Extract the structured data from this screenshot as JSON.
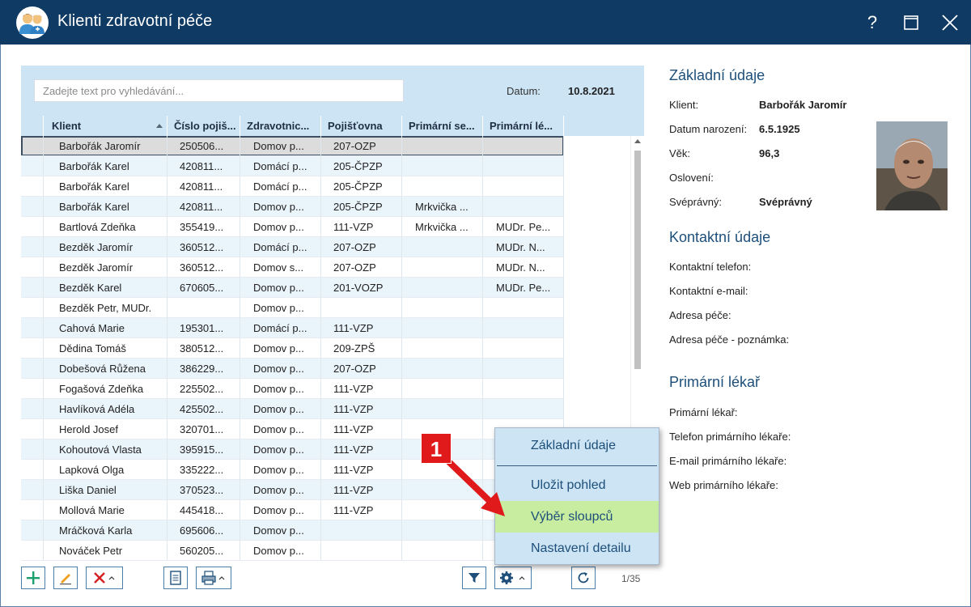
{
  "window": {
    "title": "Klienti zdravotní péče",
    "help_label": "?"
  },
  "grid": {
    "search": {
      "placeholder": "Zadejte text pro vyhledávání...",
      "value": ""
    },
    "date_label": "Datum:",
    "date_value": "10.8.2021",
    "columns": [
      "Klient",
      "Číslo pojiš...",
      "Zdravotnic...",
      "Pojišťovna",
      "Primární se...",
      "Primární lé..."
    ],
    "sorted_column": "Klient",
    "rows": [
      [
        "Barbořák Jaromír",
        "250506...",
        "Domov p...",
        "207-OZP",
        "",
        ""
      ],
      [
        "Barbořák Karel",
        "420811...",
        "Domácí p...",
        "205-ČPZP",
        "",
        ""
      ],
      [
        "Barbořák Karel",
        "420811...",
        "Domácí p...",
        "205-ČPZP",
        "",
        ""
      ],
      [
        "Barbořák Karel",
        "420811...",
        "Domov p...",
        "205-ČPZP",
        "Mrkvička ...",
        ""
      ],
      [
        "Bartlová Zdeňka",
        "355419...",
        "Domov p...",
        "111-VZP",
        "Mrkvička ...",
        "MUDr. Pe..."
      ],
      [
        "Bezděk Jaromír",
        "360512...",
        "Domácí p...",
        "207-OZP",
        "",
        "MUDr. N..."
      ],
      [
        "Bezděk Jaromír",
        "360512...",
        "Domov s...",
        "207-OZP",
        "",
        "MUDr. N..."
      ],
      [
        "Bezděk Karel",
        "670605...",
        "Domov p...",
        "201-VOZP",
        "",
        "MUDr. Pe..."
      ],
      [
        "Bezděk Petr, MUDr.",
        "",
        "Domov p...",
        "",
        "",
        ""
      ],
      [
        "Cahová Marie",
        "195301...",
        "Domácí p...",
        "111-VZP",
        "",
        ""
      ],
      [
        "Dědina Tomáš",
        "380512...",
        "Domov p...",
        "209-ZPŠ",
        "",
        ""
      ],
      [
        "Dobešová Růžena",
        "386229...",
        "Domov p...",
        "207-OZP",
        "",
        ""
      ],
      [
        "Fogašová Zdeňka",
        "225502...",
        "Domov p...",
        "111-VZP",
        "",
        ""
      ],
      [
        "Havlíková Adéla",
        "425502...",
        "Domov p...",
        "111-VZP",
        "",
        ""
      ],
      [
        "Herold Josef",
        "320701...",
        "Domov p...",
        "111-VZP",
        "",
        ""
      ],
      [
        "Kohoutová Vlasta",
        "395915...",
        "Domov p...",
        "111-VZP",
        "",
        ""
      ],
      [
        "Lapková Olga",
        "335222...",
        "Domov p...",
        "111-VZP",
        "",
        ""
      ],
      [
        "Liška Daniel",
        "370523...",
        "Domov p...",
        "111-VZP",
        "",
        ""
      ],
      [
        "Mollová Marie",
        "445418...",
        "Domov p...",
        "111-VZP",
        "",
        ""
      ],
      [
        "Mráčková Karla",
        "695606...",
        "Domov p...",
        "",
        "",
        ""
      ],
      [
        "Nováček Petr",
        "560205...",
        "Domov p...",
        "",
        "",
        ""
      ]
    ],
    "selected_row": 0,
    "record_count": "1/35"
  },
  "menu": {
    "items": [
      "Základní údaje",
      "Uložit pohled",
      "Výběr sloupců",
      "Nastavení detailu"
    ],
    "highlighted": "Výběr sloupců"
  },
  "annotation": {
    "badge": "1",
    "color": "#e01a1a"
  },
  "detail": {
    "basic_title": "Základní údaje",
    "client_label": "Klient:",
    "client_value": "Barbořák Jaromír",
    "birth_label": "Datum narození:",
    "birth_value": "6.5.1925",
    "age_label": "Věk:",
    "age_value": "96,3",
    "salutation_label": "Oslovení:",
    "competent_label": "Svéprávný:",
    "competent_value": "Svéprávný",
    "contact_title": "Kontaktní údaje",
    "phone_label": "Kontaktní telefon:",
    "email_label": "Kontaktní e-mail:",
    "address_label": "Adresa péče:",
    "address_note_label": "Adresa péče - poznámka:",
    "doctor_title": "Primární lékař",
    "doctor_label": "Primární lékař:",
    "doctor_phone_label": "Telefon primárního lékaře:",
    "doctor_email_label": "E-mail primárního lékaře:",
    "doctor_web_label": "Web primárního lékaře:"
  },
  "colors": {
    "titlebar": "#0f3a63",
    "accent": "#1d4f7a",
    "grid_header": "#cce4f4",
    "menu_highlight": "#c9eda0"
  }
}
